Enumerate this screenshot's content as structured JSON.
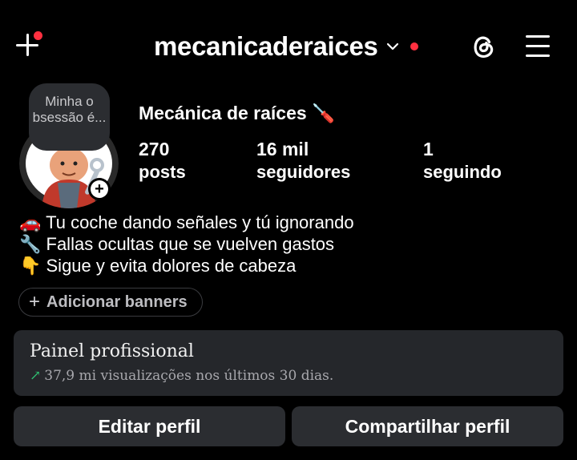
{
  "header": {
    "username": "mecanicaderaices",
    "icons": {
      "create": "plus-icon",
      "account_switch": "chevron-down-icon",
      "threads": "threads-icon",
      "menu": "hamburger-icon"
    },
    "notification_color": "#ff3040"
  },
  "profile": {
    "note": "Minha o bsessão é...",
    "display_name": "Mecánica de raíces 🪛",
    "stats": [
      {
        "value": "270",
        "label": "posts"
      },
      {
        "value": "16 mil",
        "label": "seguidores"
      },
      {
        "value": "1",
        "label": "seguindo"
      }
    ],
    "bio": [
      "🚗 Tu coche dando señales y tú ignorando",
      "🔧 Fallas ocultas que se vuelven gastos",
      "👇 Sigue y evita dolores de cabeza"
    ]
  },
  "banners_button": {
    "plus": "+",
    "label": "Adicionar banners"
  },
  "professional_panel": {
    "title": "Painel profissional",
    "trend_arrow": "↗",
    "subtitle": "37,9 mi visualizações nos últimos 30 dias.",
    "trend_color": "#2fbf71"
  },
  "actions": {
    "edit": "Editar perfil",
    "share": "Compartilhar perfil"
  }
}
